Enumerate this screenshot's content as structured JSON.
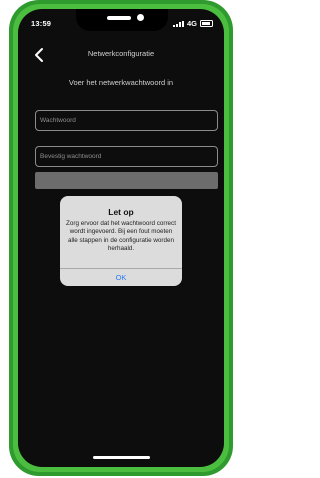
{
  "status_bar": {
    "time": "13:59",
    "network": "4G"
  },
  "nav": {
    "title": "Netwerkconfiguratie",
    "back_icon": "chevron-left-icon"
  },
  "form": {
    "instruction": "Voer het netwerkwachtwoord in",
    "password_placeholder": "Wachtwoord",
    "confirm_placeholder": "Bevestig wachtwoord"
  },
  "alert": {
    "title": "Let op",
    "message": "Zorg ervoor dat het wachtwoord correct wordt ingevoerd. Bij een fout moeten alle stappen in de configuratie worden herhaald.",
    "ok_label": "OK"
  },
  "colors": {
    "frame_green": "#4cbe3f",
    "screen_bg": "#0d0d0d",
    "alert_bg": "#dcdcdc",
    "link_blue": "#2f7cf6"
  }
}
